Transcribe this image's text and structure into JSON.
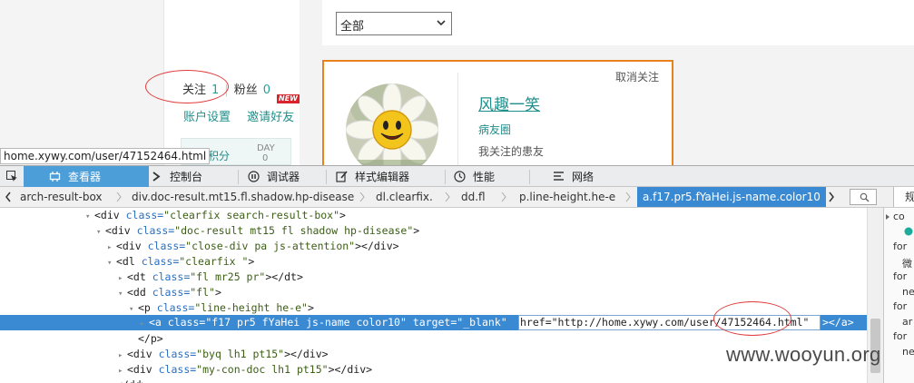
{
  "page": {
    "filter_select_value": "全部",
    "follow_label": "关注",
    "follow_count": "1",
    "fans_label": "粉丝",
    "fans_count": "0",
    "new_badge": "NEW",
    "account_settings": "账户设置",
    "invite_friends": "邀请好友",
    "earn_points": "赚积分",
    "day_label": "DAY",
    "day_value": "0",
    "hover_url": "home.xywy.com/user/47152464.html",
    "card": {
      "unfollow_label": "取消关注",
      "user_name": "风趣一笑",
      "circle_label": "病友圈",
      "friends_label": "我关注的患友"
    }
  },
  "devtools": {
    "tools": [
      {
        "label": "查看器",
        "icon": "inspector-icon",
        "active": true
      },
      {
        "label": "控制台",
        "icon": "console-icon",
        "active": false
      },
      {
        "label": "调试器",
        "icon": "debugger-icon",
        "active": false
      },
      {
        "label": "样式编辑器",
        "icon": "style-editor-icon",
        "active": false
      },
      {
        "label": "性能",
        "icon": "performance-icon",
        "active": false
      },
      {
        "label": "网络",
        "icon": "network-icon",
        "active": false
      }
    ],
    "breadcrumbs": [
      "arch-result-box",
      "div.doc-result.mt15.fl.shadow.hp-disease",
      "dl.clearfix.",
      "dd.fl",
      "p.line-height.he-e",
      "a.f17.pr5.fYaHei.js-name.color10"
    ],
    "side_tab_label": "规",
    "code_lines": [
      {
        "indent": 0,
        "tri": "▾",
        "tag_open": "<div",
        "attrs": [
          {
            "n": "class",
            "v": "clearfix search-result-box"
          }
        ],
        "tail": ">"
      },
      {
        "indent": 1,
        "tri": "▾",
        "tag_open": "<div",
        "attrs": [
          {
            "n": "class",
            "v": "doc-result mt15 fl shadow hp-disease"
          }
        ],
        "tail": ">"
      },
      {
        "indent": 2,
        "tri": "▸",
        "tag_open": "<div",
        "attrs": [
          {
            "n": "class",
            "v": "close-div pa js-attention"
          }
        ],
        "tail": "></div>"
      },
      {
        "indent": 2,
        "tri": "▾",
        "tag_open": "<dl",
        "attrs": [
          {
            "n": "class",
            "v": "clearfix "
          }
        ],
        "tail": ">"
      },
      {
        "indent": 3,
        "tri": "▸",
        "tag_open": "<dt",
        "attrs": [
          {
            "n": "class",
            "v": "fl mr25 pr"
          }
        ],
        "tail": "></dt>"
      },
      {
        "indent": 3,
        "tri": "▾",
        "tag_open": "<dd",
        "attrs": [
          {
            "n": "class",
            "v": "fl"
          }
        ],
        "tail": ">"
      },
      {
        "indent": 4,
        "tri": "▾",
        "tag_open": "<p",
        "attrs": [
          {
            "n": "class",
            "v": "line-height he-e"
          }
        ],
        "tail": ">"
      },
      {
        "indent": 5,
        "tri": "▸",
        "tag_open": "<a",
        "attrs": [
          {
            "n": "class",
            "v": "f17 pr5 fYaHei js-name color10"
          },
          {
            "n": "target",
            "v": "_blank"
          }
        ],
        "tail": ""
      },
      {
        "indent": 4,
        "tri": "",
        "tag_open": "</p>",
        "attrs": [],
        "tail": ""
      },
      {
        "indent": 3,
        "tri": "▸",
        "tag_open": "<div",
        "attrs": [
          {
            "n": "class",
            "v": "byq lh1 pt15"
          }
        ],
        "tail": "></div>"
      },
      {
        "indent": 3,
        "tri": "▸",
        "tag_open": "<div",
        "attrs": [
          {
            "n": "class",
            "v": "my-con-doc lh1 pt15"
          }
        ],
        "tail": "></div>"
      },
      {
        "indent": 2,
        "tri": "",
        "tag_open": "</dd>",
        "attrs": [],
        "tail": ""
      }
    ],
    "edit_text": "href=\"http://home.xywy.com/user/47152464.html\"",
    "edit_tail": "></a>",
    "right_panel_lines": [
      "co",
      "",
      "for",
      "微",
      "for",
      "ne",
      "for",
      "ar",
      "for",
      "ne"
    ]
  },
  "watermark": "www.wooyun.org",
  "colors": {
    "accent": "#3a8ad3",
    "teal_link": "#1f8f8a",
    "card_border": "#e8821f",
    "annotation_red": "#e23b3b"
  }
}
